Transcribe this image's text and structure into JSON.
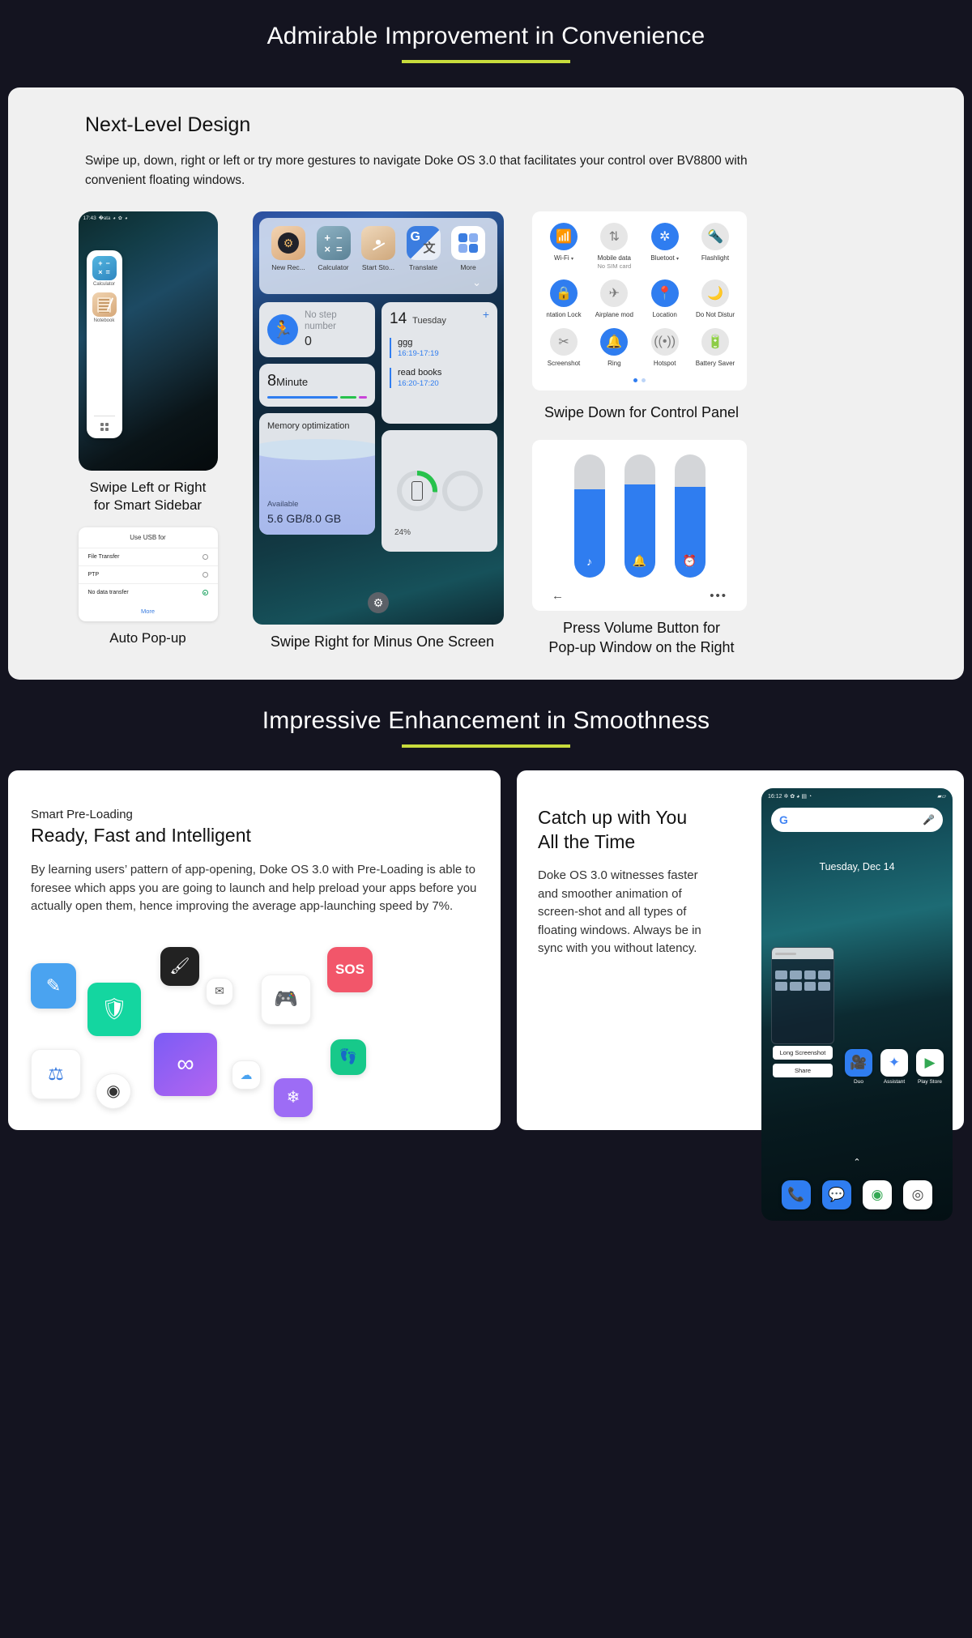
{
  "section1": {
    "heading": "Admirable Improvement in Convenience",
    "accent": "#c8dc3c",
    "card": {
      "title": "Next-Level Design",
      "body": "Swipe up, down, right or left or try more gestures to navigate Doke OS 3.0 that facilitates your control over BV8800 with convenient floating windows."
    },
    "captions": {
      "sidebar": "Swipe Left or Right\nfor Smart Sidebar",
      "autopopup": "Auto Pop-up",
      "minusone": "Swipe Right for Minus One Screen",
      "controlpanel": "Swipe Down for Control Panel",
      "volume": "Press Volume Button for\nPop-up Window on the Right"
    }
  },
  "phone_sidebar": {
    "status_time": "17:43",
    "status_icons": [
      "bluetooth-icon",
      "clock-icon",
      "gear-icon",
      "clock-icon"
    ],
    "items": [
      {
        "label": "Calculator",
        "icon": "calculator-icon"
      },
      {
        "label": "Notebook",
        "icon": "notebook-icon"
      }
    ],
    "footer_icon": "app-grid-icon"
  },
  "usb_popup": {
    "title": "Use USB for",
    "options": [
      {
        "label": "File Transfer",
        "selected": false
      },
      {
        "label": "PTP",
        "selected": false
      },
      {
        "label": "No data transfer",
        "selected": true
      }
    ],
    "more": "More",
    "selected_color": "#1aa260",
    "more_color": "#3b7de0"
  },
  "minus_one": {
    "shortcuts": [
      {
        "label": "New Rec...",
        "icon": "recorder-icon"
      },
      {
        "label": "Calculator",
        "icon": "calculator-icon"
      },
      {
        "label": "Start Sto...",
        "icon": "stopwatch-icon"
      },
      {
        "label": "Translate",
        "icon": "translate-icon"
      },
      {
        "label": "More",
        "icon": "more-grid-icon"
      }
    ],
    "steps_widget": {
      "title": "No step number",
      "value": "0",
      "icon": "running-icon"
    },
    "minutes_widget": {
      "value": "8",
      "unit": "Minute"
    },
    "memory_widget": {
      "title": "Memory optimization",
      "sub": "Available",
      "value": "5.6 GB/8.0 GB"
    },
    "calendar_widget": {
      "day_number": "14",
      "day_name": "Tuesday",
      "add_icon": "plus-icon",
      "events": [
        {
          "title": "ggg",
          "range": "16:19-17:19"
        },
        {
          "title": "read books",
          "range": "16:20-17:20"
        }
      ]
    },
    "battery_widget": {
      "percent": "24%",
      "ring_value": 24
    },
    "settings_icon": "gear-icon"
  },
  "control_panel": {
    "tiles": [
      {
        "label": "Wi-Fi",
        "sub": "",
        "icon": "wifi-icon",
        "on": true,
        "caret": true
      },
      {
        "label": "Mobile data",
        "sub": "No SIM card",
        "icon": "mobile-data-icon",
        "on": false,
        "caret": false
      },
      {
        "label": "Bluetoot",
        "sub": "",
        "icon": "bluetooth-icon",
        "on": true,
        "caret": true
      },
      {
        "label": "Flashlight",
        "sub": "",
        "icon": "flashlight-icon",
        "on": false,
        "caret": false
      },
      {
        "label": "ntation Lock",
        "sub": "",
        "icon": "rotation-lock-icon",
        "on": true,
        "caret": false
      },
      {
        "label": "Airplane mod",
        "sub": "",
        "icon": "airplane-icon",
        "on": false,
        "caret": false
      },
      {
        "label": "Location",
        "sub": "",
        "icon": "location-pin-icon",
        "on": true,
        "caret": false
      },
      {
        "label": "Do Not Distur",
        "sub": "",
        "icon": "moon-icon",
        "on": false,
        "caret": false
      },
      {
        "label": "Screenshot",
        "sub": "",
        "icon": "screenshot-icon",
        "on": false,
        "caret": false
      },
      {
        "label": "Ring",
        "sub": "",
        "icon": "bell-icon",
        "on": true,
        "caret": false
      },
      {
        "label": "Hotspot",
        "sub": "",
        "icon": "hotspot-icon",
        "on": false,
        "caret": false
      },
      {
        "label": "Battery Saver",
        "sub": "",
        "icon": "battery-saver-icon",
        "on": false,
        "caret": false
      }
    ],
    "page_dots": 2,
    "active_dot": 0,
    "accent": "#2f7df0"
  },
  "volume_panel": {
    "sliders": [
      {
        "icon": "music-note-icon",
        "level": 72
      },
      {
        "icon": "bell-icon",
        "level": 76
      },
      {
        "icon": "alarm-clock-icon",
        "level": 74
      }
    ],
    "back_icon": "back-arrow-icon",
    "more_icon": "more-dots-icon",
    "accent": "#2f7df0"
  },
  "section2": {
    "heading": "Impressive Enhancement in Smoothness",
    "left": {
      "kicker": "Smart Pre-Loading",
      "title": "Ready, Fast and Intelligent",
      "body": "By learning users’ pattern of app-opening, Doke OS 3.0 with Pre-Loading is able to foresee which apps you are going to launch and help preload your apps before you actually open them, hence improving the average app-launching speed by 7%.",
      "app_icons": [
        {
          "name": "notes-icon",
          "glyph": "✎",
          "color": "#4aa3f0"
        },
        {
          "name": "shield-icon",
          "glyph": "🛡",
          "color": "#14d6a0"
        },
        {
          "name": "paint-icon",
          "glyph": "🖌",
          "color": "#222222"
        },
        {
          "name": "message-icon",
          "glyph": "✉",
          "color": "#ffffff"
        },
        {
          "name": "game-controller-icon",
          "glyph": "🎮",
          "color": "#ffffff"
        },
        {
          "name": "sos-icon",
          "glyph": "SOS",
          "color": "#f2566a"
        },
        {
          "name": "balance-icon",
          "glyph": "⚖",
          "color": "#ffffff"
        },
        {
          "name": "camera-icon",
          "glyph": "◉",
          "color": "#ffffff"
        },
        {
          "name": "infinity-icon",
          "glyph": "∞",
          "color": "#8a5cf0"
        },
        {
          "name": "cloud-icon",
          "glyph": "☁",
          "color": "#ffffff"
        },
        {
          "name": "snowflake-icon",
          "glyph": "❄",
          "color": "#9d6cf5"
        },
        {
          "name": "footsteps-icon",
          "glyph": "👣",
          "color": "#17c98a"
        }
      ]
    },
    "right": {
      "title": "Catch up with You All the Time",
      "body": "Doke OS 3.0 witnesses faster and smoother animation of screen-shot and all types of floating windows. Always be in sync with you without latency."
    }
  },
  "phone_home": {
    "status_time": "16:12",
    "status_icons": [
      "bluetooth-icon",
      "gear-icon",
      "clock-icon",
      "sim-icon",
      "wifi-icon"
    ],
    "search": {
      "logo": "google-g-icon",
      "mic": "microphone-icon",
      "placeholder": ""
    },
    "date": "Tuesday, Dec 14",
    "floating_window_label": "",
    "actions": [
      {
        "label": "Long Screenshot"
      },
      {
        "label": "Share"
      }
    ],
    "apps": [
      {
        "label": "Duo",
        "icon": "duo-icon"
      },
      {
        "label": "Assistant",
        "icon": "assistant-icon"
      },
      {
        "label": "Play Store",
        "icon": "play-store-icon"
      }
    ],
    "caret_icon": "chevron-up-icon",
    "dock": [
      {
        "icon": "phone-icon"
      },
      {
        "icon": "messages-icon"
      },
      {
        "icon": "chrome-icon"
      },
      {
        "icon": "camera-icon"
      }
    ]
  }
}
